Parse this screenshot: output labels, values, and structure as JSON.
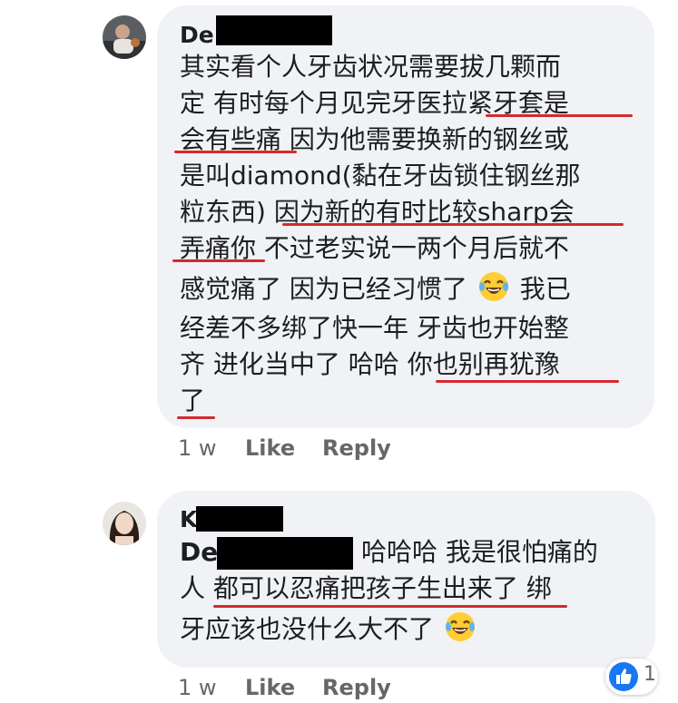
{
  "comments": [
    {
      "author": "De",
      "lines": [
        "其实看个人牙齿状况需要拔几颗而",
        "定 有时每个月见完牙医拉紧牙套是",
        "会有些痛 因为他需要换新的钢丝或",
        "是叫diamond(黏在牙齿锁住钢丝那",
        "粒东西) 因为新的有时比较sharp会",
        "弄痛你 不过老实说一两个月后就不",
        "感觉痛了 因为已经习惯了",
        "我已",
        "经差不多绑了快一年 牙齿也开始整",
        "齐 进化当中了 哈哈 你也别再犹豫",
        "了"
      ],
      "time": "1 w",
      "like_label": "Like",
      "reply_label": "Reply"
    },
    {
      "author": "K",
      "mention": "De",
      "lines": [
        "哈哈哈 我是很怕痛的",
        "人 都可以忍痛把孩子生出来了 绑",
        "牙应该也没什么大不了"
      ],
      "time": "1 w",
      "like_label": "Like",
      "reply_label": "Reply",
      "reaction_count": "1"
    }
  ],
  "colors": {
    "bubble": "#f0f2f5",
    "underline": "#d42a2e",
    "meta_text": "#65676b",
    "like_blue": "#1877f2"
  },
  "icons": [
    "laughing-tears-emoji",
    "thumbs-up-icon"
  ]
}
